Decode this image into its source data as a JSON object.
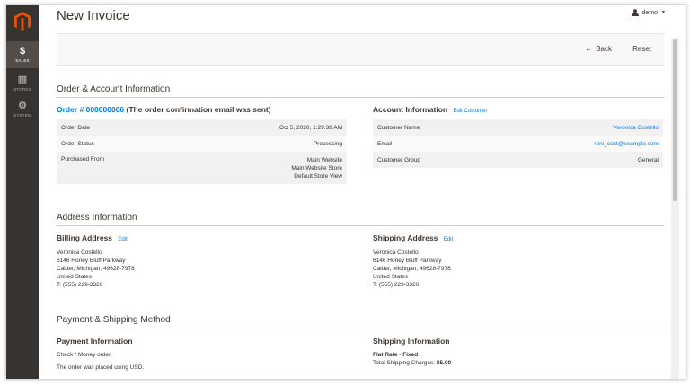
{
  "header": {
    "title": "New Invoice",
    "user": "demo"
  },
  "sidebar": {
    "items": [
      {
        "label": "SALES",
        "icon": "dollar-icon",
        "glyph": "$"
      },
      {
        "label": "STORES",
        "icon": "store-icon",
        "glyph": "▥"
      },
      {
        "label": "SYSTEM",
        "icon": "gear-icon",
        "glyph": "⚙"
      }
    ]
  },
  "actions": {
    "back_label": "Back",
    "reset_label": "Reset"
  },
  "order_account": {
    "section_title": "Order & Account Information",
    "order_link": "Order # 000000006",
    "order_note": "(The order confirmation email was sent)",
    "order_rows": [
      {
        "label": "Order Date",
        "value_lines": [
          "Oct 5, 2020, 1:29:39 AM"
        ]
      },
      {
        "label": "Order Status",
        "value_lines": [
          "Processing"
        ]
      },
      {
        "label": "Purchased From",
        "value_lines": [
          "Main Website",
          "Main Website Store",
          "Default Store View"
        ]
      }
    ],
    "account_title": "Account Information",
    "edit_customer": "Edit Customer",
    "account_rows": [
      {
        "label": "Customer Name",
        "value": "Veronica Costello"
      },
      {
        "label": "Email",
        "value": "roni_cost@example.com"
      },
      {
        "label": "Customer Group",
        "value": "General"
      }
    ]
  },
  "address": {
    "section_title": "Address Information",
    "billing_title": "Billing Address",
    "shipping_title": "Shipping Address",
    "edit_label": "Edit",
    "billing_lines": [
      "Veronica Costello",
      "6146 Honey Bluff Parkway",
      "Calder, Michigan, 49628-7978",
      "United States",
      "T: (555) 229-3326"
    ],
    "shipping_lines": [
      "Veronica Costello",
      "6146 Honey Bluff Parkway",
      "Calder, Michigan, 49628-7978",
      "United States",
      "T: (555) 229-3326"
    ]
  },
  "payment_shipping": {
    "section_title": "Payment & Shipping Method",
    "payment_title": "Payment Information",
    "payment_method": "Check / Money order",
    "payment_note": "The order was placed using USD.",
    "shipping_title": "Shipping Information",
    "shipping_method": "Flat Rate - Fixed",
    "shipping_charges_label": "Total Shipping Charges:",
    "shipping_charges_value": "$5.00"
  },
  "colors": {
    "sidebar_bg": "#373330",
    "logo": "#eb5202",
    "link": "#007bdb"
  }
}
